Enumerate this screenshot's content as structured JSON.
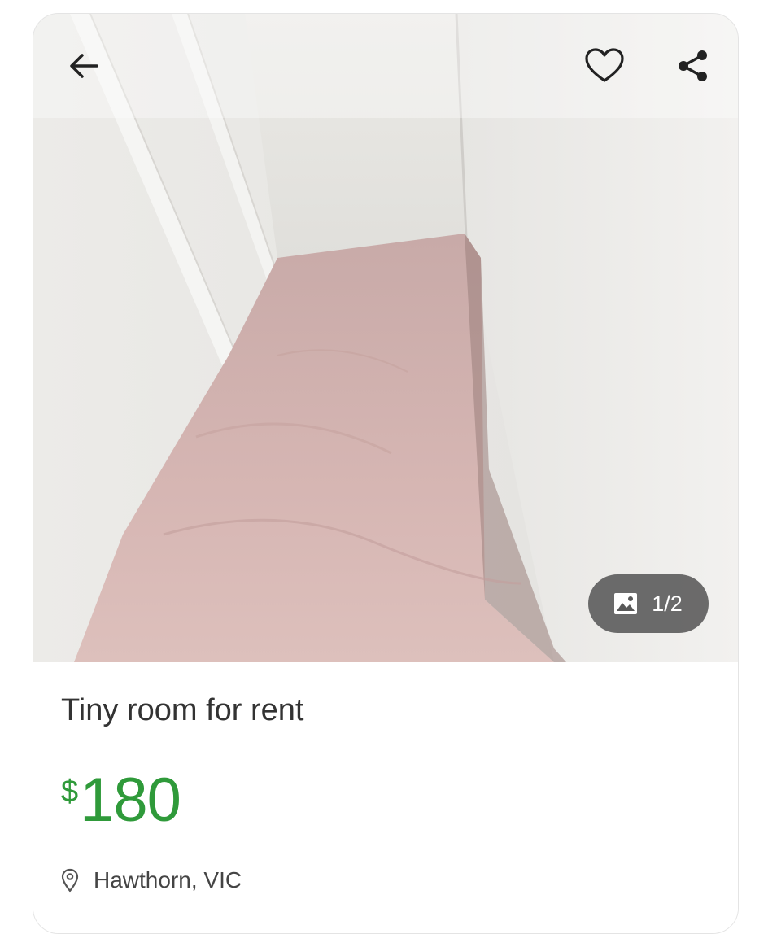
{
  "listing": {
    "title": "Tiny room for rent",
    "price_currency": "$",
    "price_amount": "180",
    "location": "Hawthorn, VIC"
  },
  "gallery": {
    "counter": "1/2"
  },
  "colors": {
    "price": "#2f9a3a",
    "counter_bg": "#585858"
  },
  "icons": {
    "back": "arrow-left-icon",
    "favorite": "heart-icon",
    "share": "share-icon",
    "gallery": "image-icon",
    "location": "map-pin-icon"
  }
}
